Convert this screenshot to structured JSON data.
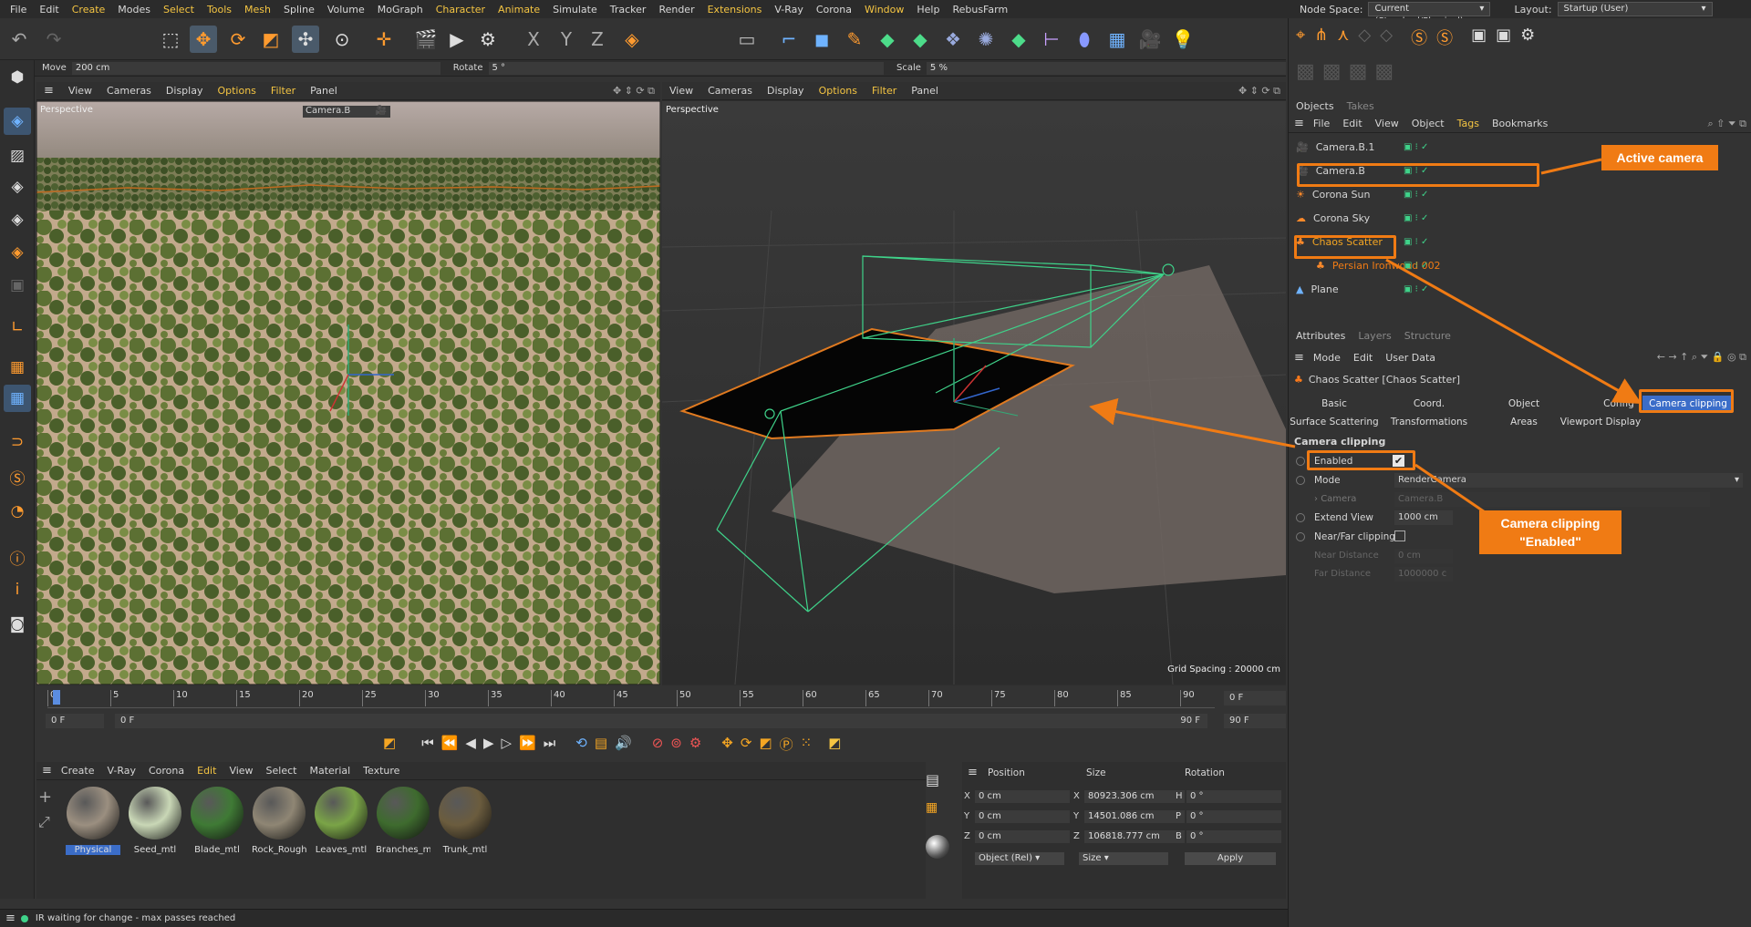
{
  "menu": [
    "File",
    "Edit",
    "Create",
    "Modes",
    "Select",
    "Tools",
    "Mesh",
    "Spline",
    "Volume",
    "MoGraph",
    "Character",
    "Animate",
    "Simulate",
    "Tracker",
    "Render",
    "Extensions",
    "V-Ray",
    "Corona",
    "Window",
    "Help",
    "RebusFarm"
  ],
  "node_space": {
    "label": "Node Space:",
    "value": "Current (Standard/Physical)"
  },
  "layout": {
    "label": "Layout:",
    "value": "Startup (User)"
  },
  "subbar": {
    "move_label": "Move",
    "move_value": "200 cm",
    "rotate_label": "Rotate",
    "rotate_value": "5 °",
    "scale_label": "Scale",
    "scale_value": "5 %"
  },
  "viewport_menu": [
    "View",
    "Cameras",
    "Display",
    "Options",
    "Filter",
    "Panel"
  ],
  "left_view": {
    "label": "Perspective",
    "camera": "Camera.B"
  },
  "right_view": {
    "label": "Perspective",
    "grid": "Grid Spacing : 20000 cm"
  },
  "objects_tabs": [
    "Objects",
    "Takes"
  ],
  "objects_menu": [
    "File",
    "Edit",
    "View",
    "Object",
    "Tags",
    "Bookmarks"
  ],
  "objects": [
    {
      "name": "Camera.B.1",
      "color": "#d6d6d6"
    },
    {
      "name": "Camera.B",
      "color": "#d6d6d6"
    },
    {
      "name": "Corona Sun",
      "color": "#d6d6d6"
    },
    {
      "name": "Corona Sky",
      "color": "#d6d6d6"
    },
    {
      "name": "Chaos Scatter",
      "color": "#f5a623"
    },
    {
      "name": "Persian Ironwood 002",
      "color": "#f07b14"
    },
    {
      "name": "Plane",
      "color": "#d6d6d6"
    }
  ],
  "attr_tabs": [
    "Attributes",
    "Layers",
    "Structure"
  ],
  "attr_menu": [
    "Mode",
    "Edit",
    "User Data"
  ],
  "attr_title": "Chaos Scatter [Chaos Scatter]",
  "attr_buttons_row1": [
    "Basic",
    "Coord.",
    "Object",
    "Config",
    "Camera clipping"
  ],
  "attr_buttons_row2": [
    "Surface Scattering",
    "Transformations",
    "Areas",
    "Viewport Display"
  ],
  "section": "Camera clipping",
  "fields": {
    "enabled": "Enabled",
    "mode": "Mode",
    "mode_value": "RenderCamera",
    "camera": "Camera",
    "camera_value": "Camera.B",
    "extend": "Extend View",
    "extend_value": "1000 cm",
    "nearfar": "Near/Far clipping",
    "near": "Near Distance",
    "near_value": "0 cm",
    "far": "Far Distance",
    "far_value": "1000000 c"
  },
  "callouts": {
    "active_camera": "Active camera",
    "clip1": "Camera clipping",
    "clip2": "\"Enabled\""
  },
  "timeline": {
    "ticks": [
      "0",
      "5",
      "10",
      "15",
      "20",
      "25",
      "30",
      "35",
      "40",
      "45",
      "50",
      "55",
      "60",
      "65",
      "70",
      "75",
      "80",
      "85",
      "90"
    ],
    "start": "0 F",
    "cur": "0 F",
    "mid": "0 F",
    "end_a": "90 F",
    "end_b": "90 F",
    "frame_r": "0 F"
  },
  "mat_menu": [
    "Create",
    "V-Ray",
    "Corona",
    "Edit",
    "View",
    "Select",
    "Material",
    "Texture"
  ],
  "materials": [
    {
      "name": "Physical",
      "color": "#9b8f80"
    },
    {
      "name": "Seed_mtl",
      "color": "#c9d7b6"
    },
    {
      "name": "Blade_mtl",
      "color": "#3f7a35"
    },
    {
      "name": "Rock_Rough",
      "color": "#8f8674"
    },
    {
      "name": "Leaves_mtl",
      "color": "#7aa447"
    },
    {
      "name": "Branches_m",
      "color": "#3e6b2e"
    },
    {
      "name": "Trunk_mtl",
      "color": "#6b5c3e"
    }
  ],
  "coords": {
    "headers": [
      "Position",
      "Size",
      "Rotation"
    ],
    "px": "0 cm",
    "py": "0 cm",
    "pz": "0 cm",
    "sx": "80923.306 cm",
    "sy": "14501.086 cm",
    "sz": "106818.777 cm",
    "rh": "0 °",
    "rp": "0 °",
    "rb": "0 °",
    "mode1": "Object (Rel)",
    "mode2": "Size",
    "apply": "Apply",
    "lx": "X",
    "ly": "Y",
    "lz": "Z",
    "lsx": "X",
    "lsy": "Y",
    "lsz": "Z",
    "lh": "H",
    "lp": "P",
    "lb": "B"
  },
  "status": "IR waiting for change - max passes reached"
}
